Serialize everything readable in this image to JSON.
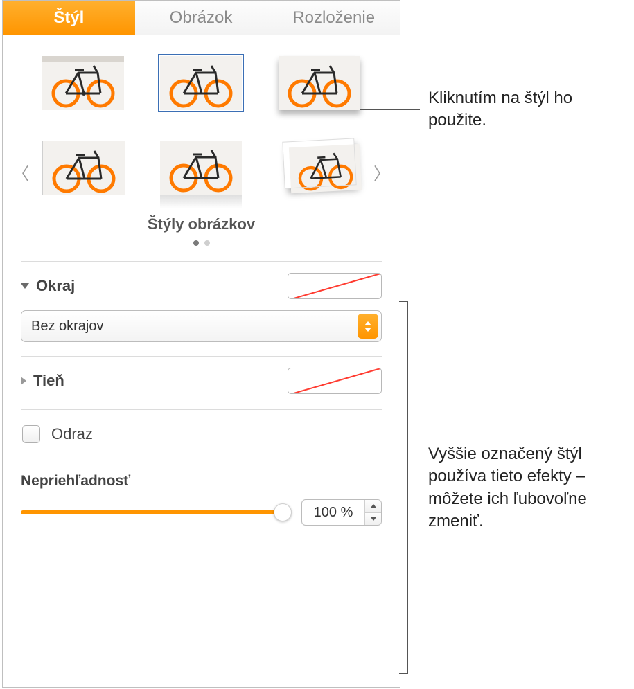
{
  "tabs": {
    "style": "Štýl",
    "image": "Obrázok",
    "layout": "Rozloženie"
  },
  "gallery": {
    "title": "Štýly obrázkov"
  },
  "border": {
    "label": "Okraj",
    "select_value": "Bez okrajov"
  },
  "shadow": {
    "label": "Tieň"
  },
  "reflection": {
    "label": "Odraz"
  },
  "opacity": {
    "label": "Nepriehľadnosť",
    "value_text": "100 %"
  },
  "callouts": {
    "apply_style": "Kliknutím na štýl ho použite.",
    "effects": "Vyššie označený štýl používa tieto efekty – môžete ich ľubovoľne zmeniť."
  }
}
